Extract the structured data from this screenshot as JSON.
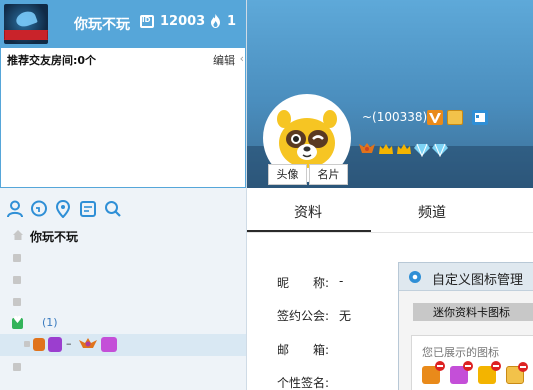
{
  "header": {
    "nickname": "你玩不玩",
    "id_number": "12003",
    "fire_count": "1"
  },
  "recommend": {
    "label": "推荐交友房间:0个",
    "edit_label": "编辑",
    "edit_chevron": "‹"
  },
  "tree": {
    "root_label": "你玩不玩",
    "group_count": "(1)",
    "member_dash": "–"
  },
  "profile": {
    "uid": "~(100338)",
    "avatar_btn": "头像",
    "card_btn": "名片"
  },
  "tabs": [
    {
      "label": "资料"
    },
    {
      "label": "频道"
    }
  ],
  "info": {
    "nickname_label": "昵　　称:",
    "nickname_value": "-",
    "guild_label": "签约公会:",
    "guild_value": "无",
    "email_label": "邮　　箱:",
    "signature_label": "个性签名:"
  },
  "dialog": {
    "title": "自定义图标管理",
    "tab": "迷你资料卡图标",
    "section_label": "您已展示的图标"
  },
  "colors": {
    "header_bg": "#56a6d9",
    "banner_top": "#5ea9d9",
    "accent_green": "#33b35a",
    "link_blue": "#3a7bbf"
  }
}
